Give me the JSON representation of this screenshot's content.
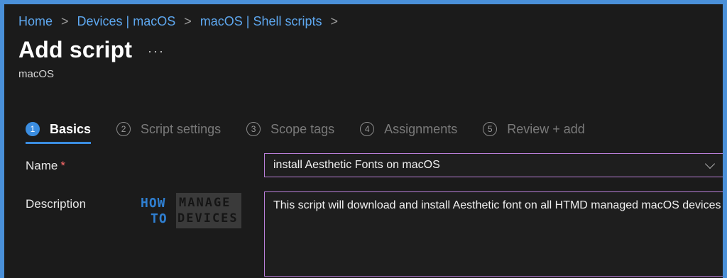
{
  "breadcrumb": {
    "items": [
      "Home",
      "Devices | macOS",
      "macOS | Shell scripts"
    ],
    "separator": ">"
  },
  "page": {
    "title": "Add script",
    "more_label": "···",
    "subtitle": "macOS"
  },
  "tabs": [
    {
      "num": "1",
      "label": "Basics",
      "active": true
    },
    {
      "num": "2",
      "label": "Script settings",
      "active": false
    },
    {
      "num": "3",
      "label": "Scope tags",
      "active": false
    },
    {
      "num": "4",
      "label": "Assignments",
      "active": false
    },
    {
      "num": "5",
      "label": "Review + add",
      "active": false
    }
  ],
  "form": {
    "name_label": "Name",
    "required_marker": "*",
    "name_value": "install Aesthetic Fonts on macOS",
    "description_label": "Description",
    "description_value": "This script will download and install Aesthetic font on all HTMD managed macOS devices"
  },
  "watermark": {
    "how": "HOW",
    "to": "TO",
    "manage": "MANAGE",
    "devices": "DEVICES"
  },
  "colors": {
    "accent": "#3b8de0",
    "link": "#5ea8f0",
    "input_border": "#b97fd8",
    "required": "#ff6b6b",
    "background": "#1b1b1b",
    "outer_frame": "#4a90d9"
  }
}
